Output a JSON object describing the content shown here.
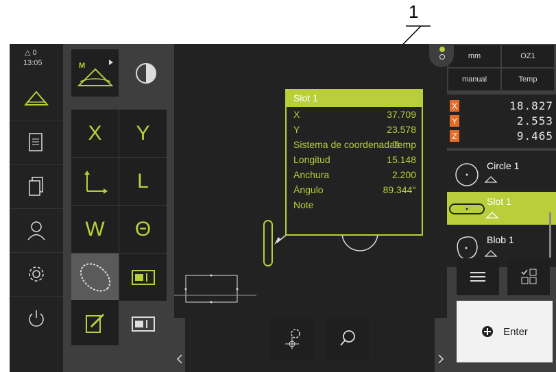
{
  "callout": {
    "number": "1"
  },
  "status": {
    "warning_count": "0",
    "time": "13:05"
  },
  "tools": {
    "x_label": "X",
    "y_label": "Y",
    "l_label": "L",
    "w_label": "W",
    "theta_label": "Θ",
    "measure_mode_letter": "M"
  },
  "topbar": {
    "unit": "mm",
    "ref": "OZ1",
    "mode": "manual",
    "temp": "Temp"
  },
  "coords": [
    {
      "axis": "X",
      "value": "18.827"
    },
    {
      "axis": "Y",
      "value": "2.553"
    },
    {
      "axis": "Z",
      "value": "9.465"
    }
  ],
  "features": [
    {
      "name": "Circle 1"
    },
    {
      "name": "Slot 1"
    },
    {
      "name": "Blob 1"
    }
  ],
  "info_box": {
    "title": "Slot 1",
    "rows": [
      {
        "key": "X",
        "value": "37.709"
      },
      {
        "key": "Y",
        "value": "23.578"
      },
      {
        "key": "Sistema de coordenadas",
        "value": "Temp"
      },
      {
        "key": "Longitud",
        "value": "15.148"
      },
      {
        "key": "Anchura",
        "value": "2.200"
      },
      {
        "key": "Ángulo",
        "value": "89.344°"
      },
      {
        "key": "Note",
        "value": ""
      }
    ]
  },
  "enter_label": "Enter",
  "colors": {
    "accent": "#b8cf3b",
    "axis_label": "#e46b28",
    "panel": "#3e3e3e",
    "dark": "#222222"
  }
}
